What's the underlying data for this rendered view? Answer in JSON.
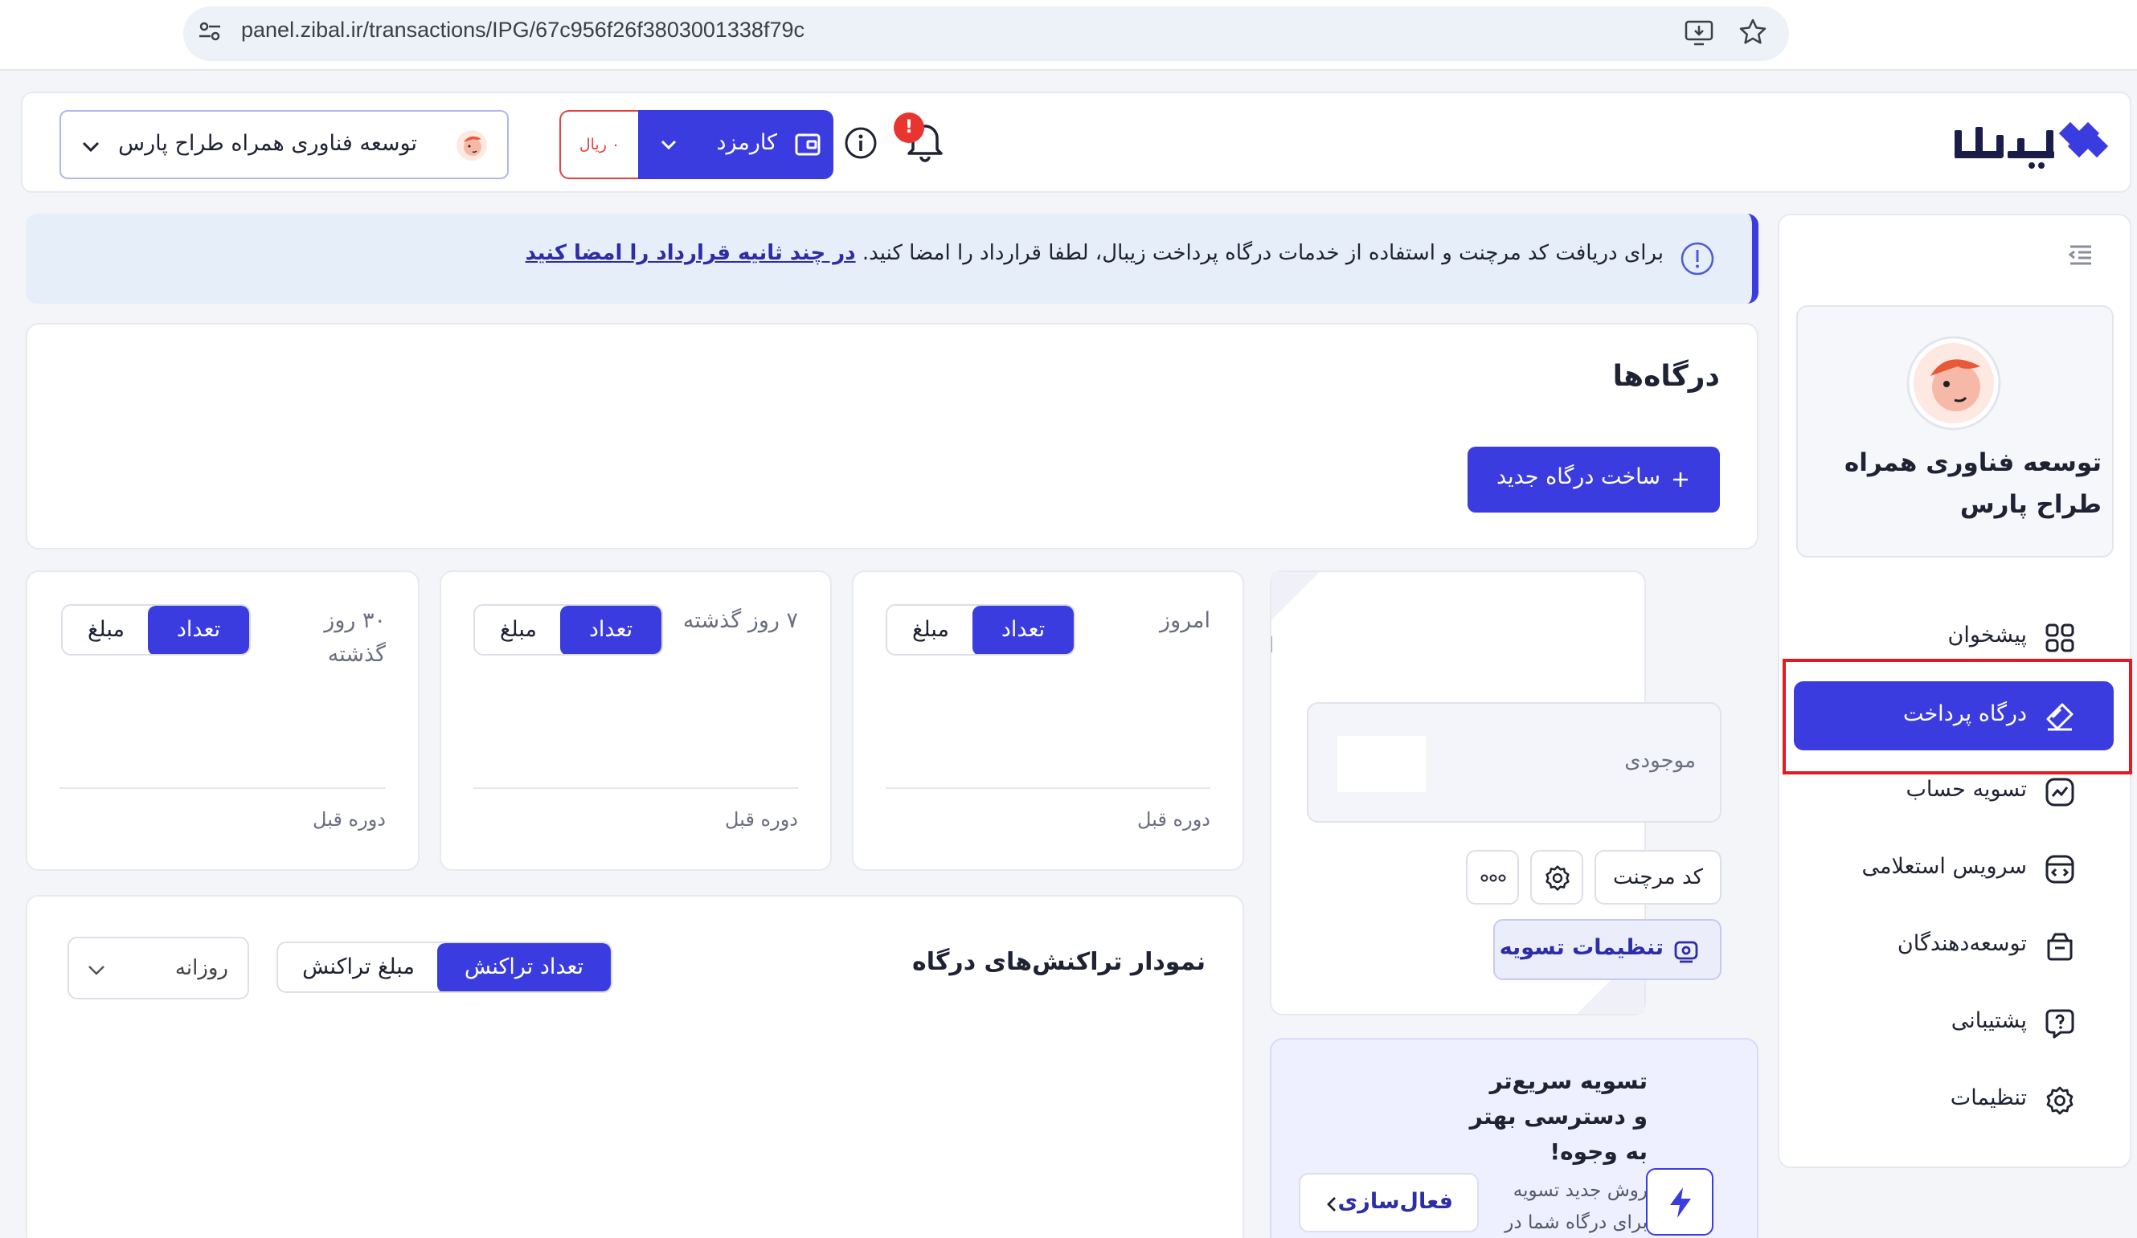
{
  "browser": {
    "url": "panel.zibal.ir/transactions/IPG/67c956f26f3803001338f79c"
  },
  "header": {
    "notification_count": "!",
    "fee_label": "کارمزد",
    "fee_amount": "۰ ریال",
    "account_name": "توسعه فناوری همراه طراح پارس"
  },
  "sidebar": {
    "profile_name": "توسعه فناوری همراه طراح پارس",
    "items": [
      {
        "label": "پیشخوان",
        "icon": "dashboard-grid-icon"
      },
      {
        "label": "درگاه پرداخت",
        "icon": "payment-gateway-icon",
        "active": true
      },
      {
        "label": "تسویه حساب",
        "icon": "settlement-chart-icon"
      },
      {
        "label": "سرویس استعلامی",
        "icon": "inquiry-service-icon"
      },
      {
        "label": "توسعه‌دهندگان",
        "icon": "developers-icon"
      },
      {
        "label": "پشتیبانی",
        "icon": "support-question-icon"
      },
      {
        "label": "تنظیمات",
        "icon": "gear-icon"
      }
    ]
  },
  "alert": {
    "text": "برای دریافت کد مرچنت و استفاده از خدمات درگاه پرداخت زیبال، لطفا قرارداد را امضا کنید.",
    "link": "در چند ثانیه قرارداد را امضا کنید"
  },
  "gateways": {
    "title": "درگاه‌ها",
    "new_button": "ساخت درگاه جدید"
  },
  "stats": [
    {
      "label": "امروز",
      "seg_on": "تعداد",
      "seg_off": "مبلغ",
      "prev": "دوره قبل"
    },
    {
      "label": "۷ روز گذشته",
      "seg_on": "تعداد",
      "seg_off": "مبلغ",
      "prev": "دوره قبل"
    },
    {
      "label": "۳۰ روز\nگذشته",
      "seg_on": "تعداد",
      "seg_off": "مبلغ",
      "prev": "دوره قبل"
    }
  ],
  "balance": {
    "label": "موجودی",
    "merchant_button": "کد مرچنت",
    "settlement_settings": "تنظیمات تسویه"
  },
  "promo": {
    "title": "تسویه سریع‌تر\nو دسترسی بهتر\nبه وجوه!",
    "subtitle": "روش جدید تسویه\nبرای درگاه شما در",
    "activate": "فعال‌سازی"
  },
  "chart": {
    "title": "نمودار تراکنش‌های درگاه",
    "seg_on": "تعداد تراکنش",
    "seg_off": "مبلغ تراکنش",
    "period": "روزانه"
  },
  "colors": {
    "primary": "#3b3ce0",
    "danger": "#e74040",
    "highlight": "#e01b22"
  }
}
